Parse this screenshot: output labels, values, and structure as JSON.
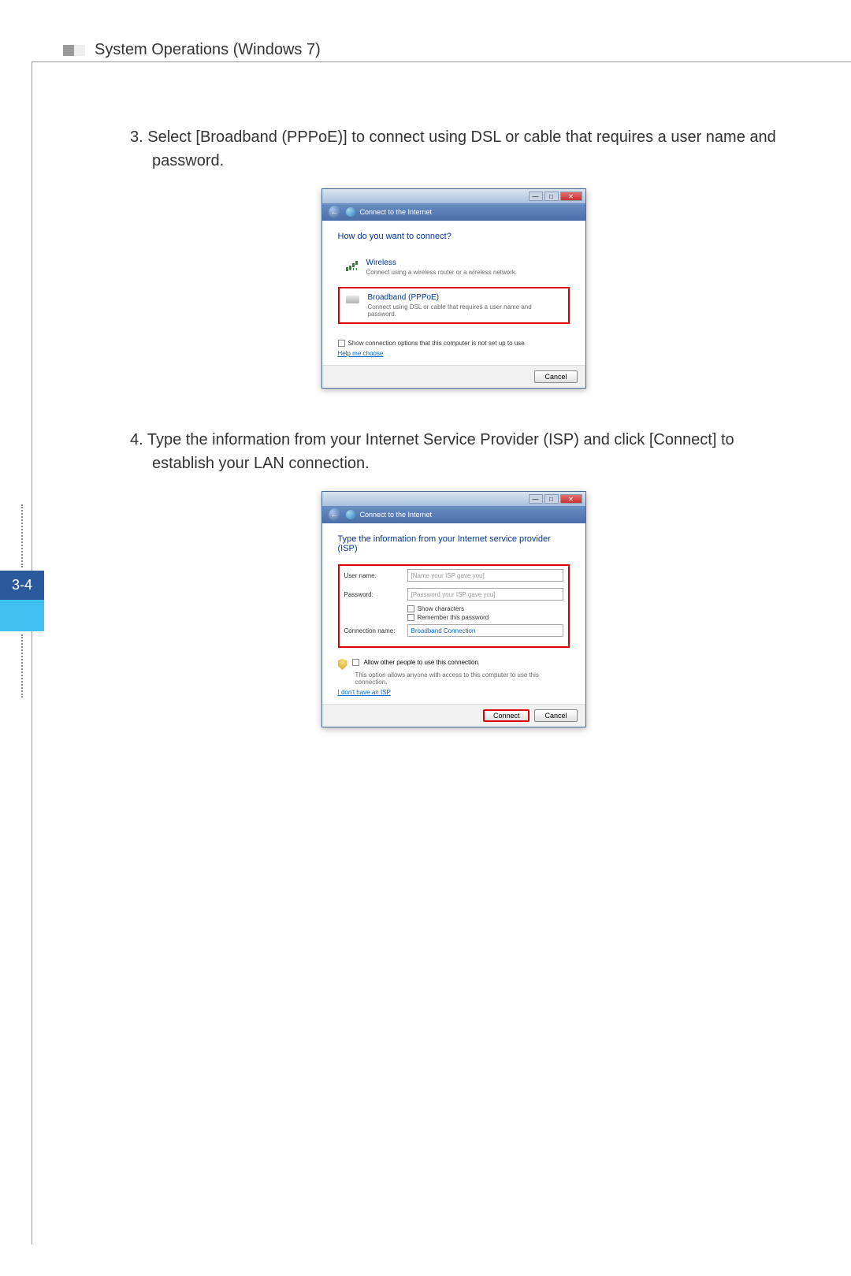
{
  "header": {
    "title": "System Operations (Windows 7)"
  },
  "page_number": "3-4",
  "steps": [
    {
      "num": "3.",
      "text": "Select [Broadband (PPPoE)] to connect using DSL or cable that requires a user name and password."
    },
    {
      "num": "4.",
      "text": "Type the information from your Internet Service Provider (ISP) and click [Connect] to establish your LAN connection."
    }
  ],
  "dialog1": {
    "breadcrumb": "Connect to the Internet",
    "heading": "How do you want to connect?",
    "opt1_title": "Wireless",
    "opt1_desc": "Connect using a wireless router or a wireless network.",
    "opt2_title": "Broadband (PPPoE)",
    "opt2_desc": "Connect using DSL or cable that requires a user name and password.",
    "show_options": "Show connection options that this computer is not set up to use",
    "help": "Help me choose",
    "cancel": "Cancel"
  },
  "dialog2": {
    "breadcrumb": "Connect to the Internet",
    "heading": "Type the information from your Internet service provider (ISP)",
    "label_user": "User name:",
    "ph_user": "[Name your ISP gave you]",
    "label_pw": "Password:",
    "ph_pw": "[Password your ISP gave you]",
    "show_chars": "Show characters",
    "remember": "Remember this password",
    "label_conn": "Connection name:",
    "conn_value": "Broadband Connection",
    "allow_label": "Allow other people to use this connection",
    "allow_desc": "This option allows anyone with access to this computer to use this connection.",
    "no_isp": "I don't have an ISP",
    "connect": "Connect",
    "cancel": "Cancel"
  }
}
